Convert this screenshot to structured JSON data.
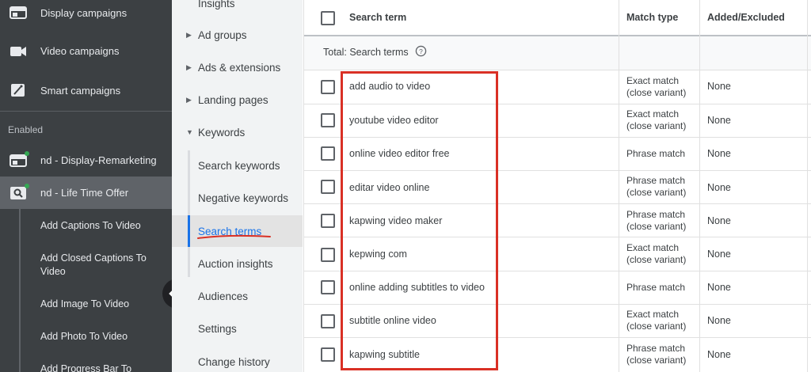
{
  "left_nav": {
    "items": [
      {
        "label": "Display campaigns",
        "icon": "display-icon"
      },
      {
        "label": "Video campaigns",
        "icon": "video-icon"
      },
      {
        "label": "Smart campaigns",
        "icon": "wand-icon"
      }
    ],
    "section_label": "Enabled",
    "campaigns": [
      {
        "label": "nd - Display-Remarketing",
        "icon": "display-icon"
      },
      {
        "label": "nd - Life Time Offer",
        "icon": "search-campaign-icon"
      }
    ],
    "ad_groups": [
      "Add Captions To Video",
      "Add Closed Captions To Video",
      "Add Image To Video",
      "Add Photo To Video",
      "Add Progress Bar To"
    ]
  },
  "mid_nav": {
    "items": [
      {
        "label": "Insights",
        "caret": false
      },
      {
        "label": "Ad groups",
        "caret": true
      },
      {
        "label": "Ads & extensions",
        "caret": true
      },
      {
        "label": "Landing pages",
        "caret": true
      },
      {
        "label": "Keywords",
        "caret": true,
        "expanded": true
      },
      {
        "label": "Search keywords",
        "caret": false
      },
      {
        "label": "Negative keywords",
        "caret": false
      },
      {
        "label": "Search terms",
        "caret": false,
        "selected": true
      },
      {
        "label": "Auction insights",
        "caret": false
      },
      {
        "label": "Audiences",
        "caret": false
      },
      {
        "label": "Settings",
        "caret": false
      },
      {
        "label": "Change history",
        "caret": false
      }
    ]
  },
  "table": {
    "headers": {
      "search_term": "Search term",
      "match_type": "Match type",
      "added_excluded": "Added/Excluded"
    },
    "total_label": "Total: Search terms",
    "rows": [
      {
        "term": "add audio to video",
        "match1": "Exact match",
        "match2": "(close variant)",
        "added": "None"
      },
      {
        "term": "youtube video editor",
        "match1": "Exact match",
        "match2": "(close variant)",
        "added": "None"
      },
      {
        "term": "online video editor free",
        "match1": "Phrase match",
        "match2": "",
        "added": "None"
      },
      {
        "term": "editar video online",
        "match1": "Phrase match",
        "match2": "(close variant)",
        "added": "None"
      },
      {
        "term": "kapwing video maker",
        "match1": "Phrase match",
        "match2": "(close variant)",
        "added": "None"
      },
      {
        "term": "kepwing com",
        "match1": "Exact match",
        "match2": "(close variant)",
        "added": "None"
      },
      {
        "term": "online adding subtitles to video",
        "match1": "Phrase match",
        "match2": "",
        "added": "None"
      },
      {
        "term": "subtitle online video",
        "match1": "Exact match",
        "match2": "(close variant)",
        "added": "None"
      },
      {
        "term": "kapwing subtitle",
        "match1": "Phrase match",
        "match2": "(close variant)",
        "added": "None"
      }
    ]
  },
  "colors": {
    "sidebar": "#3c4043",
    "accent": "#1a73e8",
    "highlight": "#d93025"
  }
}
